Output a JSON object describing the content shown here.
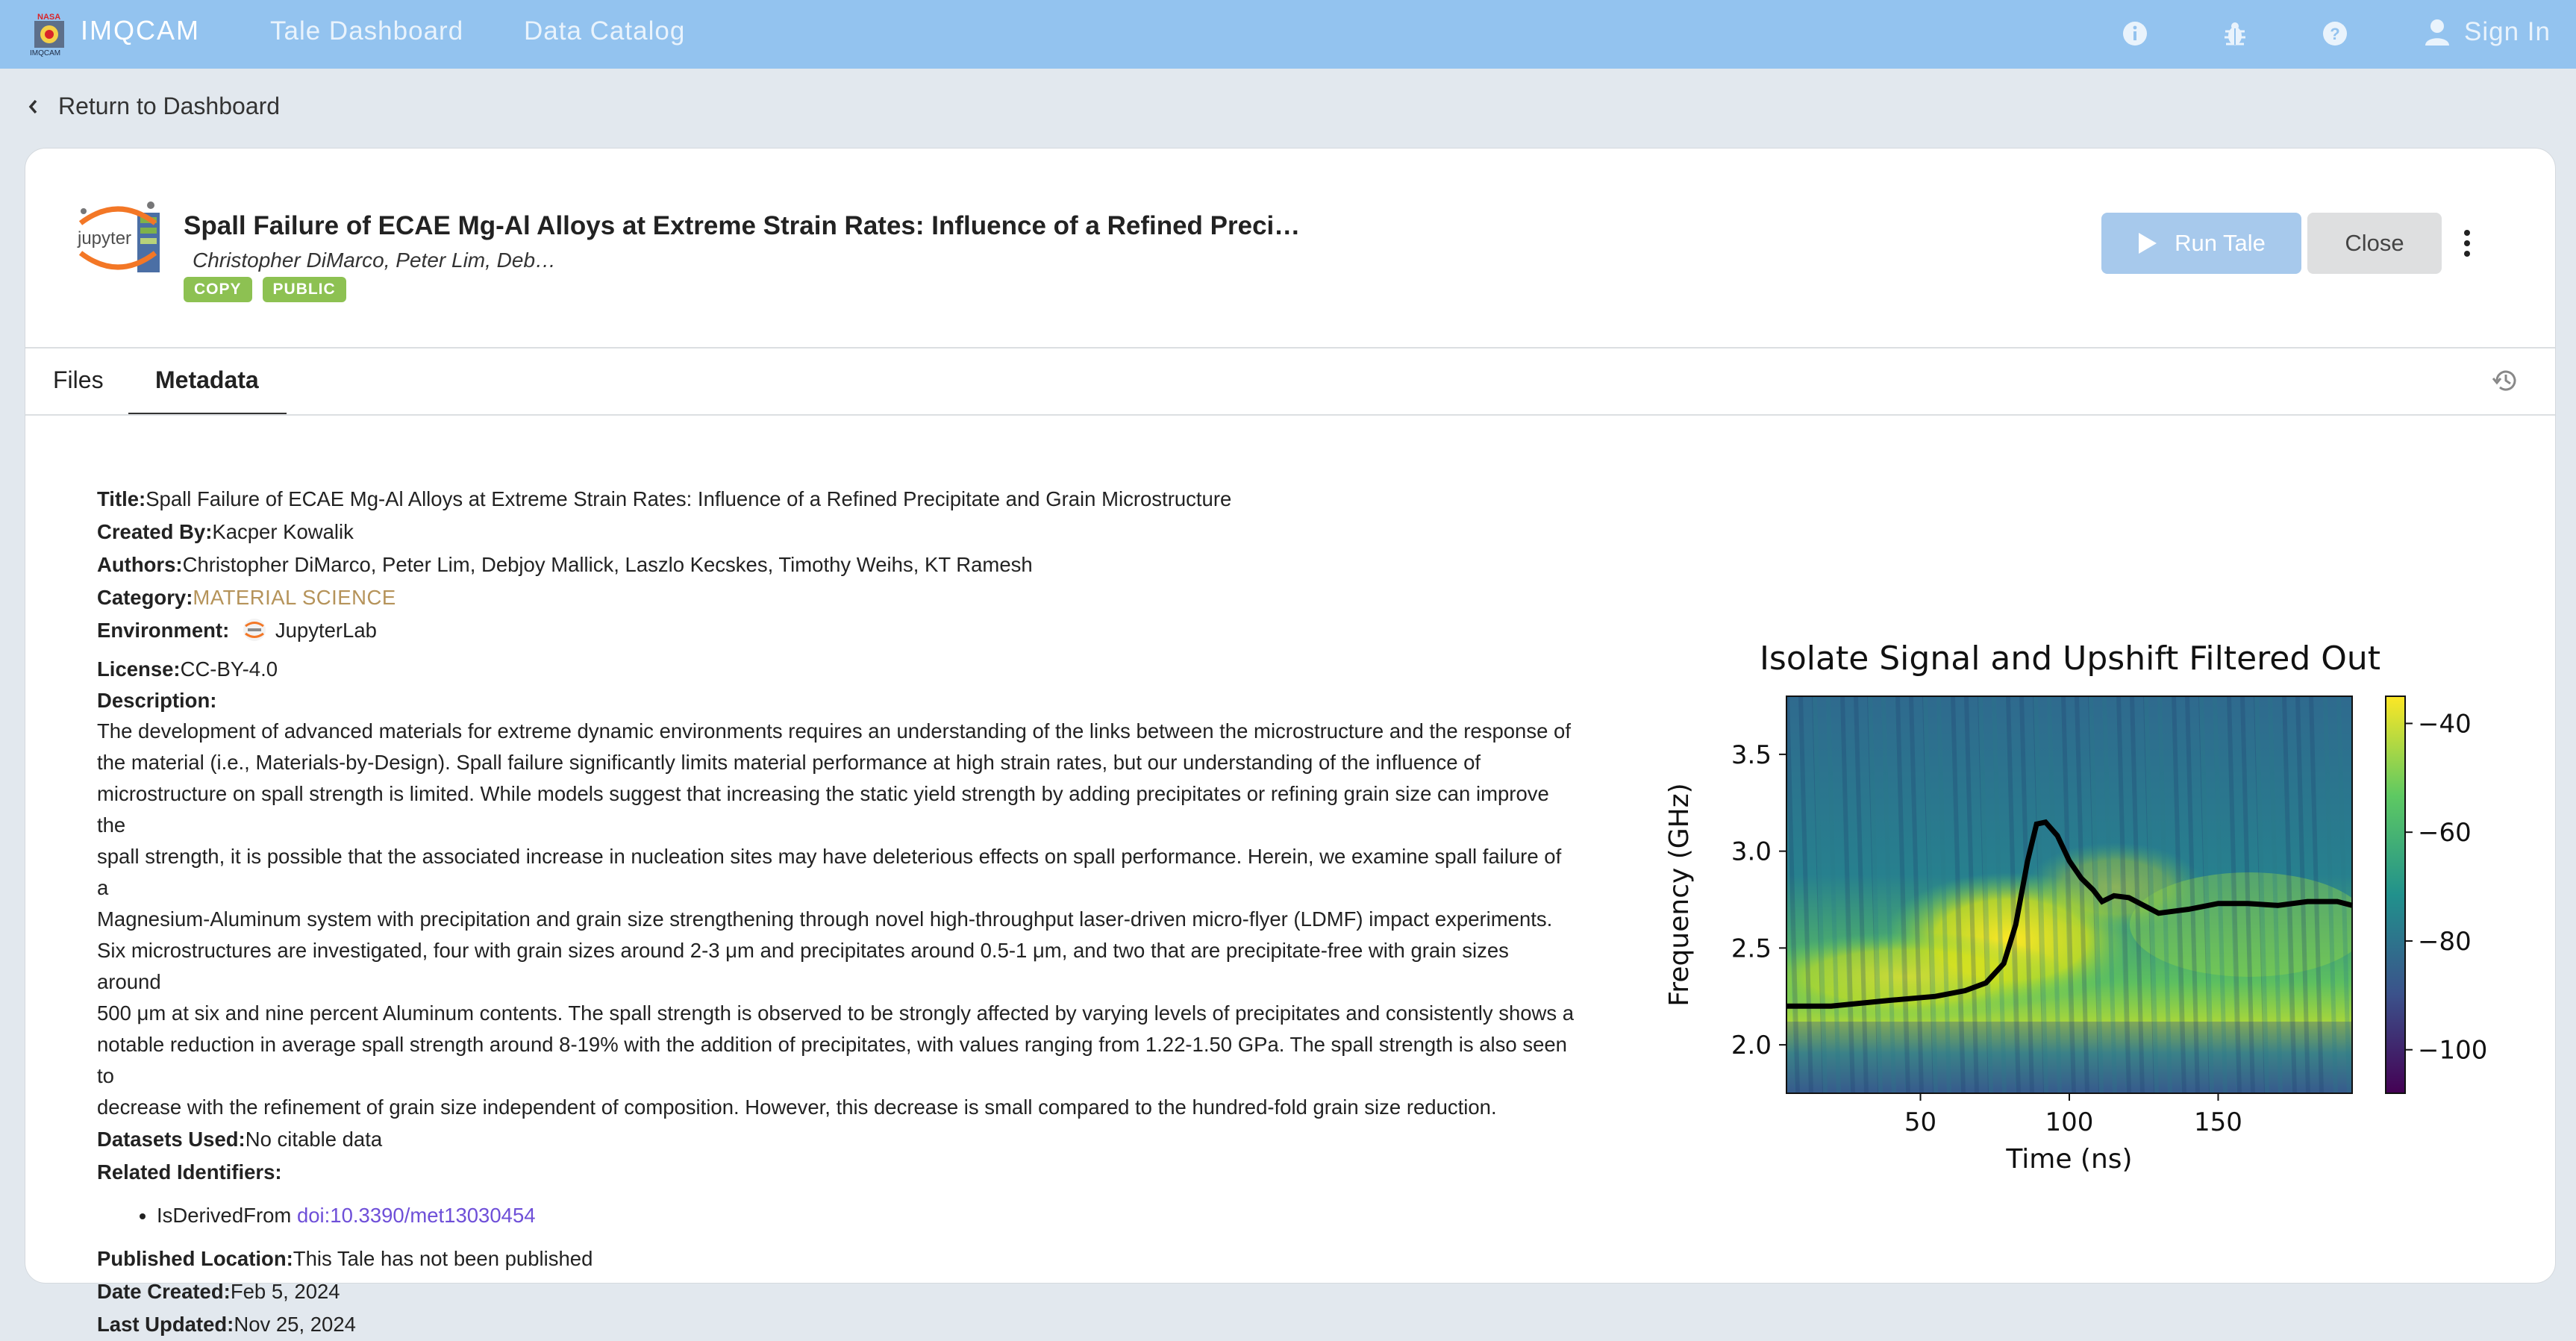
{
  "nav": {
    "brand": "IMQCAM",
    "logo_text": "NASA IMQCAM",
    "links": [
      "Tale Dashboard",
      "Data Catalog"
    ],
    "signin": "Sign In",
    "icons": [
      "info-icon",
      "bug-icon",
      "help-icon",
      "user-icon"
    ]
  },
  "back_label": "Return to Dashboard",
  "tale": {
    "title": "Spall Failure of ECAE Mg-Al Alloys at Extreme Strain Rates: Influence of a Refined Preci…",
    "authors_short": "Christopher DiMarco, Peter Lim, Deb…",
    "tags": [
      "COPY",
      "PUBLIC"
    ],
    "logo_text": "jupyter",
    "run_label": "Run Tale",
    "close_label": "Close"
  },
  "tabs": [
    "Files",
    "Metadata"
  ],
  "active_tab": "Metadata",
  "metadata": {
    "title_label": "Title:",
    "title": "Spall Failure of ECAE Mg-Al Alloys at Extreme Strain Rates: Influence of a Refined Precipitate and Grain Microstructure",
    "created_by_label": "Created By:",
    "created_by": "Kacper Kowalik",
    "authors_label": "Authors:",
    "authors": "Christopher DiMarco, Peter Lim, Debjoy Mallick, Laszlo Kecskes, Timothy Weihs, KT Ramesh",
    "category_label": "Category:",
    "category": "MATERIAL SCIENCE",
    "environment_label": "Environment:",
    "environment": "JupyterLab",
    "license_label": "License:",
    "license": "CC-BY-4.0",
    "description_label": "Description:",
    "description_lines": [
      "The development of advanced materials for extreme dynamic environments requires an understanding of the links between the microstructure and the response of",
      "the material (i.e., Materials-by-Design). Spall failure significantly limits material performance at high strain rates, but our understanding of the influence of",
      "microstructure on spall strength is limited. While models suggest that increasing the static yield strength by adding precipitates or refining grain size can improve the",
      "spall strength, it is possible that the associated increase in nucleation sites may have deleterious effects on spall performance. Herein, we examine spall failure of a",
      "Magnesium-Aluminum system with precipitation and grain size strengthening through novel high-throughput laser-driven micro-flyer (LDMF) impact experiments.",
      "Six microstructures are investigated, four with grain sizes around 2-3 μm and precipitates around 0.5-1 μm, and two that are precipitate-free with grain sizes around",
      "500 μm at six and nine percent Aluminum contents. The spall strength is observed to be strongly affected by varying levels of precipitates and consistently shows a",
      "notable reduction in average spall strength around 8-19% with the addition of precipitates, with values ranging from 1.22-1.50 GPa. The spall strength is also seen to",
      "decrease with the refinement of grain size independent of composition. However, this decrease is small compared to the hundred-fold grain size reduction."
    ],
    "datasets_label": "Datasets Used:",
    "datasets": "No citable data",
    "related_label": "Related Identifiers:",
    "related_relation": "IsDerivedFrom",
    "related_doi": "doi:10.3390/met13030454",
    "published_label": "Published Location:",
    "published": "This Tale has not been published",
    "date_created_label": "Date Created:",
    "date_created": "Feb 5, 2024",
    "last_updated_label": "Last Updated:",
    "last_updated": "Nov 25, 2024"
  },
  "chart_data": {
    "type": "heatmap",
    "title": "Isolate Signal and Upshift Filtered Out",
    "xlabel": "Time (ns)",
    "ylabel": "Frequency (GHz)",
    "xlim": [
      5,
      195
    ],
    "ylim": [
      1.75,
      3.8
    ],
    "xticks": [
      50,
      100,
      150
    ],
    "yticks": [
      2.0,
      2.5,
      3.0,
      3.5
    ],
    "colorbar_ticks": [
      -40,
      -60,
      -80,
      -100
    ],
    "colorbar_range": [
      -108,
      -35
    ],
    "colormap": "viridis",
    "overlay_line": {
      "x": [
        5,
        20,
        40,
        55,
        65,
        72,
        78,
        82,
        86,
        89,
        92,
        96,
        100,
        104,
        108,
        111,
        115,
        120,
        130,
        140,
        150,
        160,
        170,
        180,
        190,
        195
      ],
      "y": [
        2.2,
        2.2,
        2.23,
        2.25,
        2.28,
        2.32,
        2.42,
        2.62,
        2.95,
        3.14,
        3.15,
        3.08,
        2.95,
        2.86,
        2.8,
        2.74,
        2.77,
        2.76,
        2.68,
        2.7,
        2.73,
        2.73,
        2.72,
        2.74,
        2.74,
        2.72
      ]
    }
  }
}
